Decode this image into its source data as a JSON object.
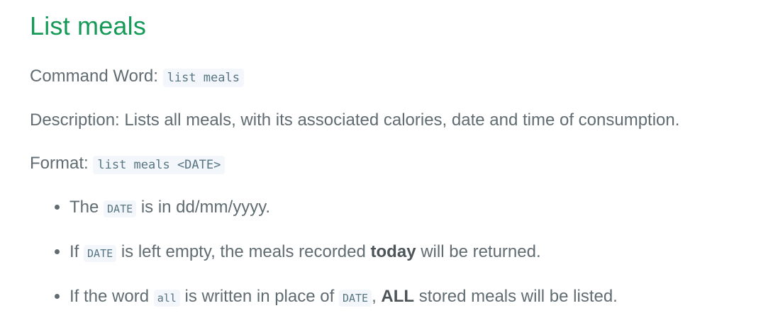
{
  "title": "List meals",
  "command": {
    "label": "Command Word:",
    "code": "list meals"
  },
  "description": {
    "text": "Description: Lists all meals, with its associated calories, date and time of consumption."
  },
  "format": {
    "label": "Format:",
    "code": "list meals <DATE>"
  },
  "bullets": [
    {
      "pre": "The",
      "code": "DATE",
      "post": "is in dd/mm/yyyy."
    },
    {
      "pre": "If",
      "code": "DATE",
      "mid": "is left empty, the meals recorded",
      "bold": "today",
      "post": "will be returned."
    },
    {
      "pre": "If the word",
      "code1": "all",
      "mid": "is written in place of",
      "code2": "DATE",
      "comma": ",",
      "bold": "ALL",
      "post": "stored meals will be listed."
    }
  ]
}
